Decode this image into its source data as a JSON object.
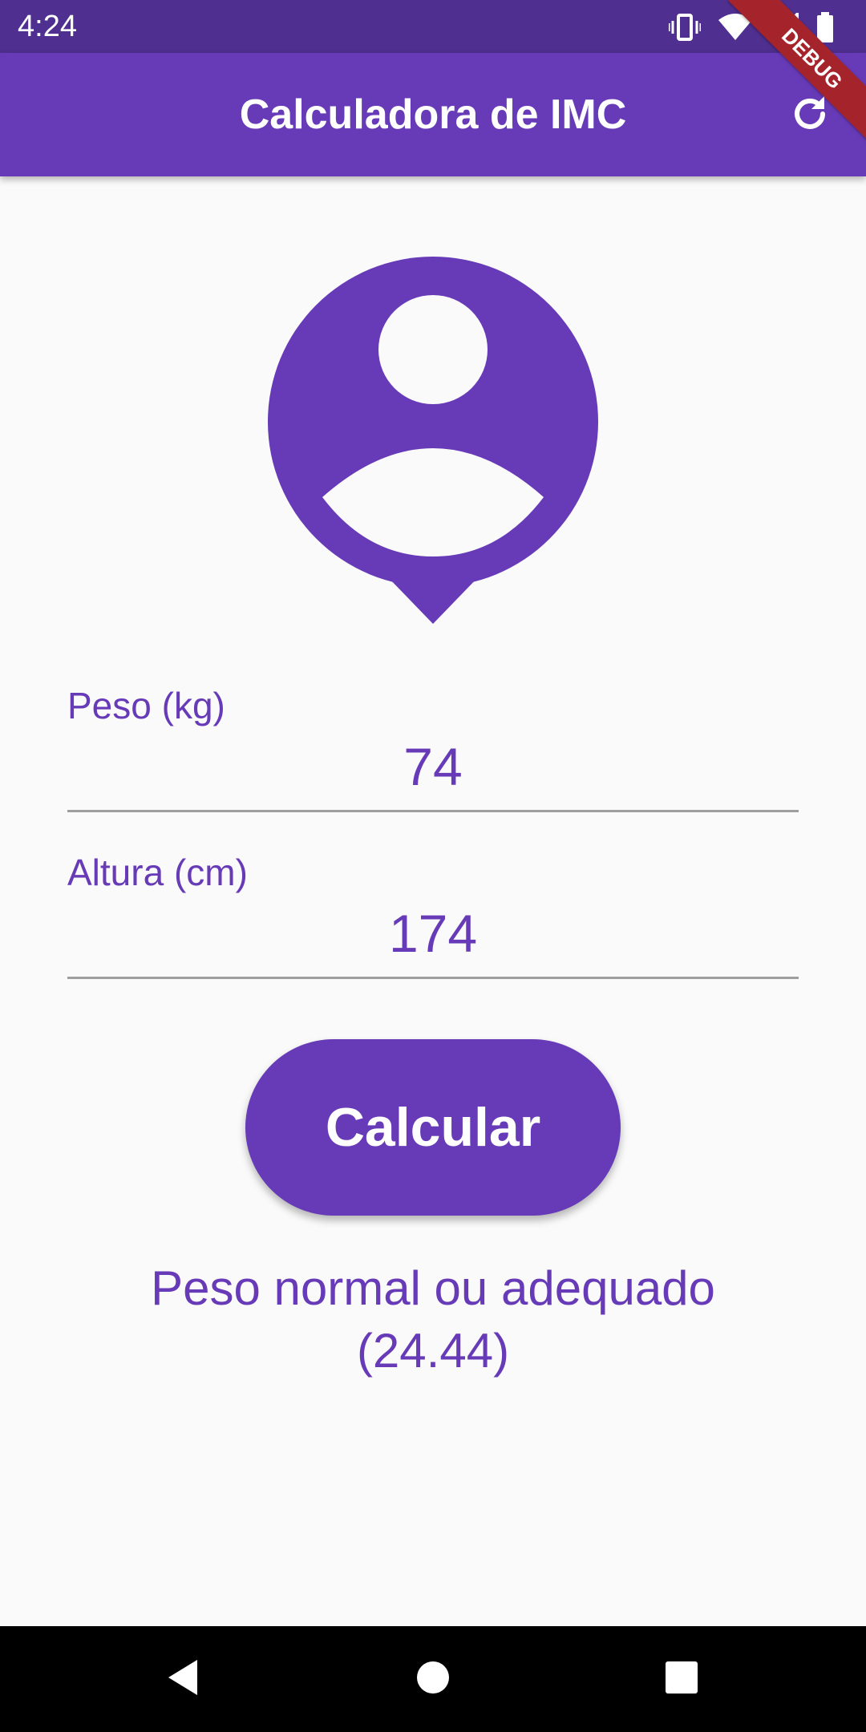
{
  "status_bar": {
    "time": "4:24",
    "icons": [
      "vibrate-icon",
      "wifi-icon",
      "signal-icon",
      "battery-icon"
    ]
  },
  "app_bar": {
    "title": "Calculadora de IMC",
    "action_icon": "refresh-icon"
  },
  "debug_banner": "DEBUG",
  "avatar_icon": "person-pin-icon",
  "form": {
    "weight": {
      "label": "Peso (kg)",
      "value": "74"
    },
    "height": {
      "label": "Altura (cm)",
      "value": "174"
    },
    "button_label": "Calcular"
  },
  "result": {
    "line1": "Peso normal ou adequado",
    "line2": "(24.44)"
  },
  "nav_bar": {
    "icons": [
      "back-icon",
      "home-icon",
      "recents-icon"
    ]
  },
  "colors": {
    "primary": "#673ab7",
    "status_bar": "#4f2f8f",
    "background": "#fafafa",
    "debug": "#a5232b"
  }
}
